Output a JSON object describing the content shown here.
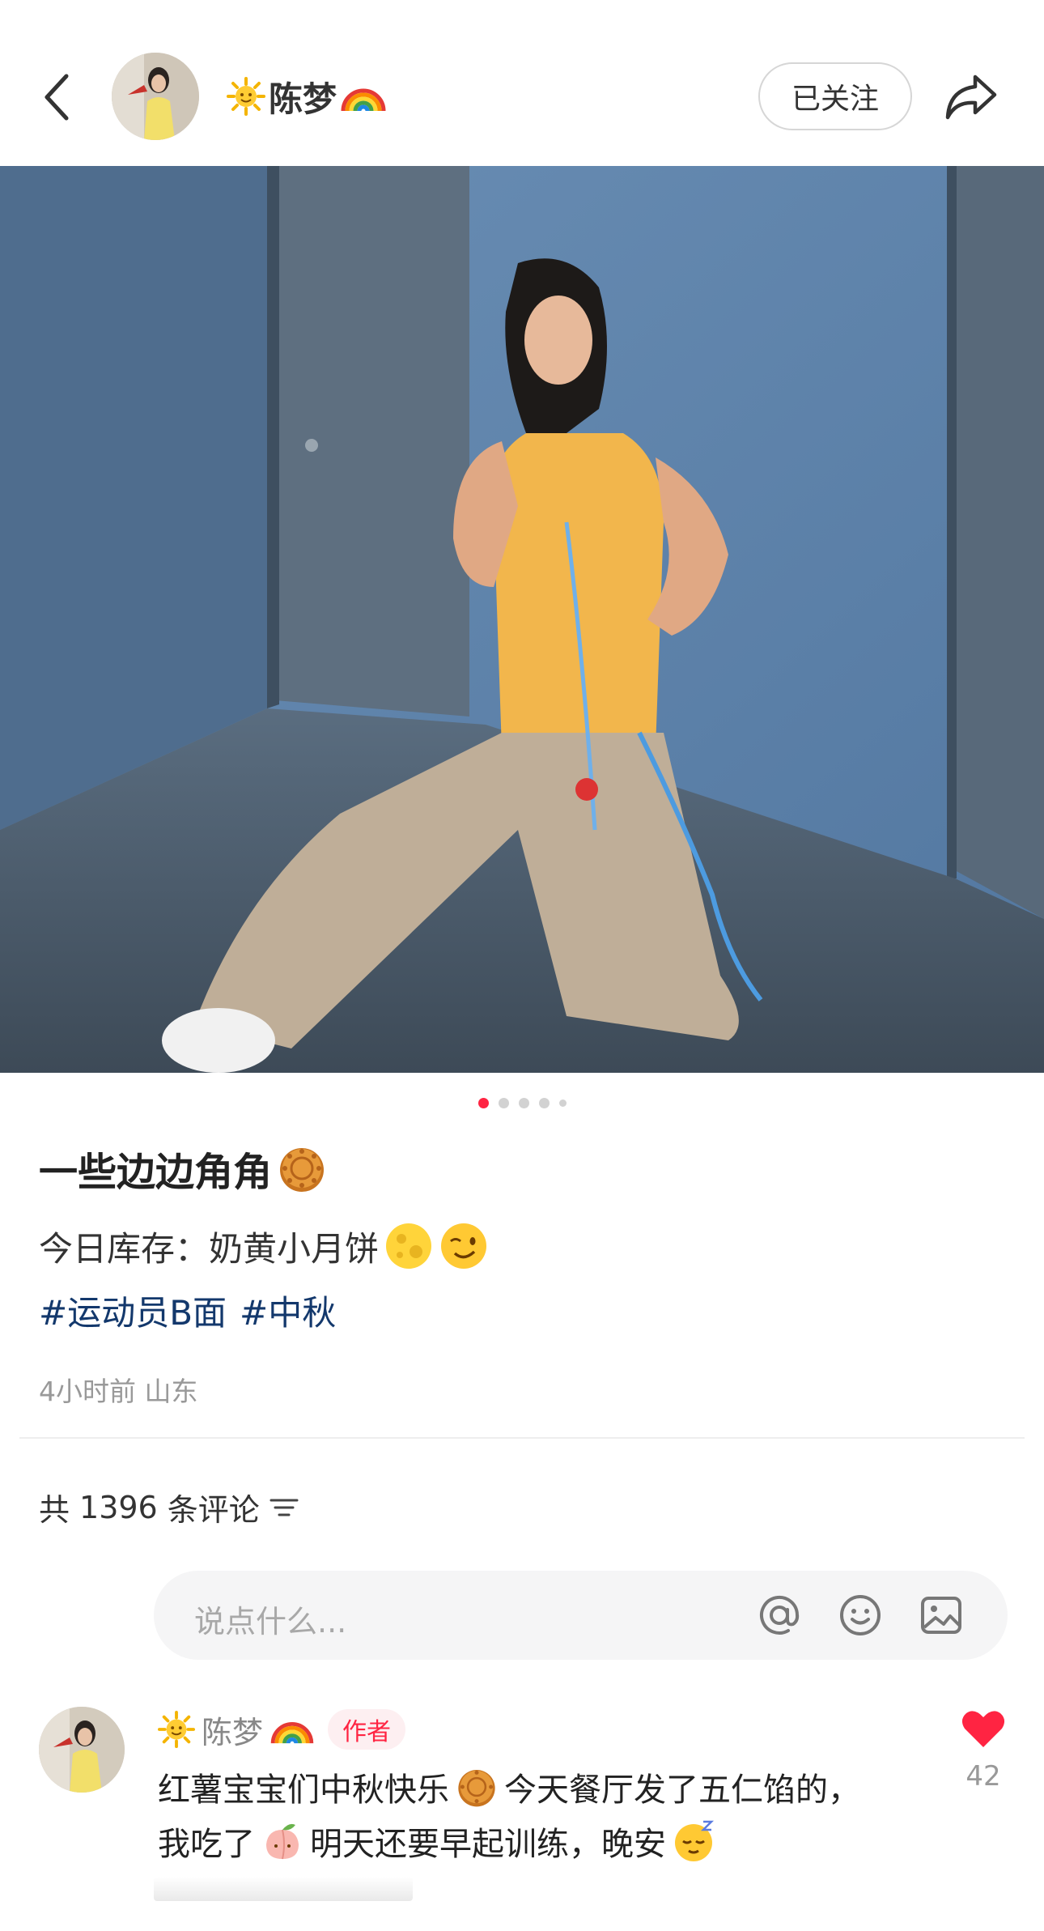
{
  "header": {
    "author_name": "陈梦",
    "follow_label": "已关注"
  },
  "gallery": {
    "total_images": 5,
    "current_index": 1
  },
  "post": {
    "title": "一些边边角角",
    "body": "今日库存：奶黄小月饼",
    "hashtags": [
      "#运动员B面",
      "#中秋"
    ],
    "time": "4小时前",
    "location": "山东"
  },
  "comments": {
    "count_prefix": "共",
    "count": "1396",
    "count_suffix": "条评论",
    "input_placeholder": "说点什么..."
  },
  "comment_list": [
    {
      "author": "陈梦",
      "badge": "作者",
      "line1_a": "红薯宝宝们中秋快乐",
      "line1_b": "今天餐厅发了五仁馅的，",
      "line2_a": "我吃了",
      "line2_b": "明天还要早起训练，晚安",
      "likes": "42"
    }
  ],
  "colors": {
    "accent": "#ff2442",
    "hashtag": "#13386c",
    "muted": "#999999"
  },
  "icons": [
    "back-arrow-icon",
    "share-icon",
    "at-icon",
    "emoji-icon",
    "image-icon",
    "filter-icon",
    "heart-icon",
    "sun-emoji-icon",
    "rainbow-emoji-icon",
    "mooncake-emoji-icon",
    "moon-emoji-icon",
    "wink-emoji-icon",
    "peach-emoji-icon",
    "sleepy-emoji-icon"
  ]
}
